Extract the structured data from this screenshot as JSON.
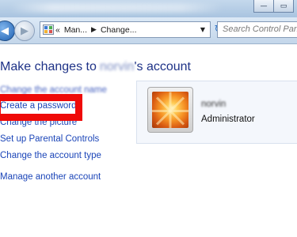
{
  "window": {
    "minimize_glyph": "—",
    "maximize_glyph": "▭"
  },
  "navigation": {
    "back_glyph": "◀",
    "forward_glyph": "▶",
    "address_overflow": "«",
    "breadcrumb": [
      "Man...",
      "Change..."
    ],
    "breadcrumb_separator": "▶",
    "address_dropdown_glyph": "▼",
    "refresh_glyph": "↻",
    "search_placeholder": "Search Control Panel"
  },
  "content": {
    "heading_prefix": "Make changes to",
    "user_name": "norvin",
    "heading_suffix": "'s account",
    "links": [
      "Change the account name",
      "Create a password",
      "Change the picture",
      "Set up Parental Controls",
      "Change the account type",
      "Manage another account"
    ]
  },
  "account_card": {
    "name": "norvin",
    "role": "Administrator"
  },
  "colors": {
    "highlight_box": "#ef0a08",
    "link": "#1b45b8",
    "heading": "#1e3287"
  }
}
